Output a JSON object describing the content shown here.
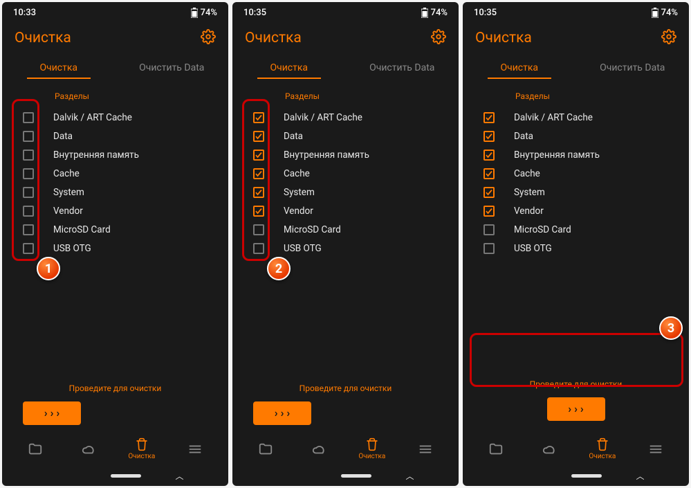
{
  "accent": "#ff7a00",
  "screens": [
    {
      "time": "10:33",
      "battery": "74%",
      "title": "Очистка",
      "tabs": {
        "clean": "Очистка",
        "clear_data": "Очистить Data"
      },
      "section_label": "Разделы",
      "partitions": [
        {
          "label": "Dalvik / ART Cache",
          "checked": false
        },
        {
          "label": "Data",
          "checked": false
        },
        {
          "label": "Внутренняя память",
          "checked": false
        },
        {
          "label": "Cache",
          "checked": false
        },
        {
          "label": "System",
          "checked": false
        },
        {
          "label": "Vendor",
          "checked": false
        },
        {
          "label": "MicroSD Card",
          "checked": false
        },
        {
          "label": "USB OTG",
          "checked": false
        }
      ],
      "swipe_hint": "Проведите для очистки",
      "nav_label": "Очистка",
      "highlight": {
        "target": "checkboxes",
        "badge": "1"
      }
    },
    {
      "time": "10:35",
      "battery": "74%",
      "title": "Очистка",
      "tabs": {
        "clean": "Очистка",
        "clear_data": "Очистить Data"
      },
      "section_label": "Разделы",
      "partitions": [
        {
          "label": "Dalvik / ART Cache",
          "checked": true
        },
        {
          "label": "Data",
          "checked": true
        },
        {
          "label": "Внутренняя память",
          "checked": true
        },
        {
          "label": "Cache",
          "checked": true
        },
        {
          "label": "System",
          "checked": true
        },
        {
          "label": "Vendor",
          "checked": true
        },
        {
          "label": "MicroSD Card",
          "checked": false
        },
        {
          "label": "USB OTG",
          "checked": false
        }
      ],
      "swipe_hint": "Проведите для очистки",
      "nav_label": "Очистка",
      "highlight": {
        "target": "checkboxes",
        "badge": "2"
      }
    },
    {
      "time": "10:35",
      "battery": "74%",
      "title": "Очистка",
      "tabs": {
        "clean": "Очистка",
        "clear_data": "Очистить Data"
      },
      "section_label": "Разделы",
      "partitions": [
        {
          "label": "Dalvik / ART Cache",
          "checked": true
        },
        {
          "label": "Data",
          "checked": true
        },
        {
          "label": "Внутренняя память",
          "checked": true
        },
        {
          "label": "Cache",
          "checked": true
        },
        {
          "label": "System",
          "checked": true
        },
        {
          "label": "Vendor",
          "checked": true
        },
        {
          "label": "MicroSD Card",
          "checked": false
        },
        {
          "label": "USB OTG",
          "checked": false
        }
      ],
      "swipe_hint": "Проведите для очистки",
      "nav_label": "Очистка",
      "highlight": {
        "target": "swipe",
        "badge": "3"
      }
    }
  ]
}
